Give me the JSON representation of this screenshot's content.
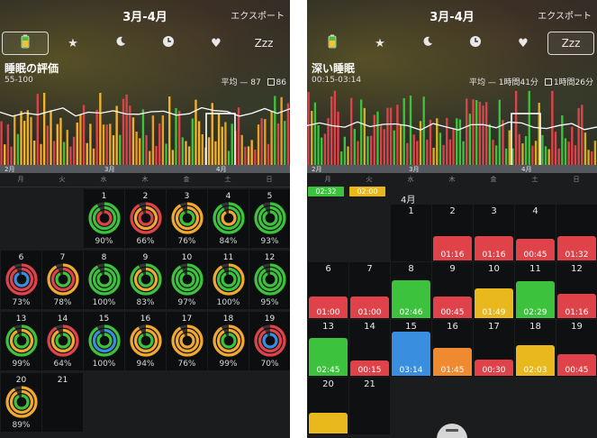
{
  "left": {
    "title": "3月-4月",
    "export_label": "エクスポート",
    "tabs": [
      "battery",
      "star",
      "moon",
      "clock",
      "heart",
      "Zzz"
    ],
    "selected_tab": 0,
    "metric": {
      "title": "睡眠の評価",
      "range": "55-100",
      "avg_label": "平均",
      "avg_value": "87",
      "box_value": "86"
    },
    "months": [
      "2月",
      "3月",
      "4月"
    ],
    "weekdays": [
      "月",
      "火",
      "水",
      "木",
      "金",
      "土",
      "日"
    ],
    "calendar": [
      {
        "day": "1",
        "pct": "90%",
        "col": 2,
        "row": 0,
        "rings": [
          "#3cc23c",
          "#3cc23c",
          "#e0424a"
        ]
      },
      {
        "day": "2",
        "pct": "66%",
        "col": 3,
        "row": 0,
        "rings": [
          "#e0424a",
          "#f0a830",
          "#e0424a"
        ]
      },
      {
        "day": "3",
        "pct": "76%",
        "col": 4,
        "row": 0,
        "rings": [
          "#f0a830",
          "#f0a830",
          "#3cc23c"
        ]
      },
      {
        "day": "4",
        "pct": "84%",
        "col": 5,
        "row": 0,
        "rings": [
          "#3cc23c",
          "#3cc23c",
          "#f0a830"
        ]
      },
      {
        "day": "5",
        "pct": "93%",
        "col": 6,
        "row": 0,
        "rings": [
          "#3cc23c",
          "#3cc23c",
          "#3cc23c"
        ]
      },
      {
        "day": "6",
        "pct": "73%",
        "col": 0,
        "row": 1,
        "rings": [
          "#e0424a",
          "#e0424a",
          "#3a8ee0"
        ]
      },
      {
        "day": "7",
        "pct": "78%",
        "col": 1,
        "row": 1,
        "rings": [
          "#f0a830",
          "#e0424a",
          "#3cc23c"
        ]
      },
      {
        "day": "8",
        "pct": "100%",
        "col": 2,
        "row": 1,
        "rings": [
          "#3cc23c",
          "#3cc23c",
          "#3cc23c"
        ]
      },
      {
        "day": "9",
        "pct": "83%",
        "col": 3,
        "row": 1,
        "rings": [
          "#3cc23c",
          "#f0a830",
          "#3cc23c"
        ]
      },
      {
        "day": "10",
        "pct": "97%",
        "col": 4,
        "row": 1,
        "rings": [
          "#3cc23c",
          "#3cc23c",
          "#3cc23c"
        ]
      },
      {
        "day": "11",
        "pct": "100%",
        "col": 5,
        "row": 1,
        "rings": [
          "#f0a830",
          "#3cc23c",
          "#3cc23c"
        ]
      },
      {
        "day": "12",
        "pct": "95%",
        "col": 6,
        "row": 1,
        "rings": [
          "#3cc23c",
          "#3cc23c",
          "#3cc23c"
        ]
      },
      {
        "day": "13",
        "pct": "99%",
        "col": 0,
        "row": 2,
        "rings": [
          "#3cc23c",
          "#f0a830",
          "#3cc23c"
        ]
      },
      {
        "day": "14",
        "pct": "64%",
        "col": 1,
        "row": 2,
        "rings": [
          "#e0424a",
          "#f0a830",
          "#3cc23c"
        ]
      },
      {
        "day": "15",
        "pct": "100%",
        "col": 2,
        "row": 2,
        "rings": [
          "#3cc23c",
          "#3a8ee0",
          "#3cc23c"
        ]
      },
      {
        "day": "16",
        "pct": "94%",
        "col": 3,
        "row": 2,
        "rings": [
          "#f0a830",
          "#f0a830",
          "#3cc23c"
        ]
      },
      {
        "day": "17",
        "pct": "76%",
        "col": 4,
        "row": 2,
        "rings": [
          "#f0a830",
          "#f0a830",
          "#f0a830"
        ]
      },
      {
        "day": "18",
        "pct": "99%",
        "col": 5,
        "row": 2,
        "rings": [
          "#f0a830",
          "#f0a830",
          "#3cc23c"
        ]
      },
      {
        "day": "19",
        "pct": "70%",
        "col": 6,
        "row": 2,
        "rings": [
          "#e0424a",
          "#e0424a",
          "#3a8ee0"
        ]
      },
      {
        "day": "20",
        "pct": "89%",
        "col": 0,
        "row": 3,
        "rings": [
          "#f0a830",
          "#f0a830",
          "#3cc23c"
        ]
      },
      {
        "day": "21",
        "pct": "",
        "col": 1,
        "row": 3,
        "rings": []
      }
    ]
  },
  "right": {
    "title": "3月-4月",
    "export_label": "エクスポート",
    "tabs": [
      "battery",
      "star",
      "moon",
      "clock",
      "heart",
      "Zzz"
    ],
    "selected_tab": 5,
    "metric": {
      "title": "深い睡眠",
      "range": "00:15-03:14",
      "avg_label": "平均",
      "avg_value": "1時間41分",
      "box_value": "1時間26分"
    },
    "months": [
      "2月",
      "3月",
      "4月"
    ],
    "weekdays": [
      "月",
      "火",
      "水",
      "木",
      "金",
      "土",
      "日"
    ],
    "month_heading": "4月",
    "top_chips": [
      {
        "time": "02:32",
        "color": "#3cc23c"
      },
      {
        "time": "02:00",
        "color": "#e8b81c"
      }
    ],
    "calendar": [
      {
        "day": "1",
        "time": "",
        "col": 2,
        "row": 0,
        "level": 0,
        "color": ""
      },
      {
        "day": "2",
        "time": "01:16",
        "col": 3,
        "row": 0,
        "level": 0.38,
        "color": "#e0424a"
      },
      {
        "day": "3",
        "time": "01:16",
        "col": 4,
        "row": 0,
        "level": 0.38,
        "color": "#e0424a"
      },
      {
        "day": "4",
        "time": "00:45",
        "col": 5,
        "row": 0,
        "level": 0.32,
        "color": "#e0424a"
      },
      {
        "day": "5",
        "time": "00:45",
        "col": 6,
        "row": 0,
        "level": 0.32,
        "color": "#e0424a"
      },
      {
        "day": "",
        "time": "01:32",
        "col": 7,
        "row": 0,
        "level": 0.38,
        "color": "#e0424a"
      },
      {
        "day": "6",
        "time": "01:00",
        "col": 0,
        "row": 1,
        "level": 0.32,
        "color": "#e0424a"
      },
      {
        "day": "7",
        "time": "01:00",
        "col": 1,
        "row": 1,
        "level": 0.32,
        "color": "#e0424a"
      },
      {
        "day": "8",
        "time": "02:46",
        "col": 2,
        "row": 1,
        "level": 0.64,
        "color": "#3cc23c"
      },
      {
        "day": "9",
        "time": "00:45",
        "col": 3,
        "row": 1,
        "level": 0.32,
        "color": "#e0424a"
      },
      {
        "day": "10",
        "time": "01:49",
        "col": 4,
        "row": 1,
        "level": 0.48,
        "color": "#e8b81c"
      },
      {
        "day": "11",
        "time": "02:29",
        "col": 5,
        "row": 1,
        "level": 0.62,
        "color": "#3cc23c"
      },
      {
        "day": "12",
        "time": "01:16",
        "col": 6,
        "row": 1,
        "level": 0.38,
        "color": "#e0424a"
      },
      {
        "day": "13",
        "time": "02:45",
        "col": 0,
        "row": 2,
        "level": 0.64,
        "color": "#3cc23c"
      },
      {
        "day": "14",
        "time": "00:15",
        "col": 1,
        "row": 2,
        "level": 0.2,
        "color": "#e0424a"
      },
      {
        "day": "15",
        "time": "03:14",
        "col": 2,
        "row": 2,
        "level": 0.76,
        "color": "#3a8ee0"
      },
      {
        "day": "16",
        "time": "01:45",
        "col": 3,
        "row": 2,
        "level": 0.45,
        "color": "#f08a30"
      },
      {
        "day": "17",
        "time": "00:30",
        "col": 4,
        "row": 2,
        "level": 0.22,
        "color": "#e0424a"
      },
      {
        "day": "18",
        "time": "02:03",
        "col": 5,
        "row": 2,
        "level": 0.5,
        "color": "#e8b81c"
      },
      {
        "day": "19",
        "time": "00:45",
        "col": 6,
        "row": 2,
        "level": 0.32,
        "color": "#e0424a"
      },
      {
        "day": "20",
        "time": "",
        "col": 0,
        "row": 3,
        "level": 0.3,
        "color": "#e8b81c"
      },
      {
        "day": "21",
        "time": "",
        "col": 1,
        "row": 3,
        "level": 0,
        "color": ""
      }
    ]
  }
}
